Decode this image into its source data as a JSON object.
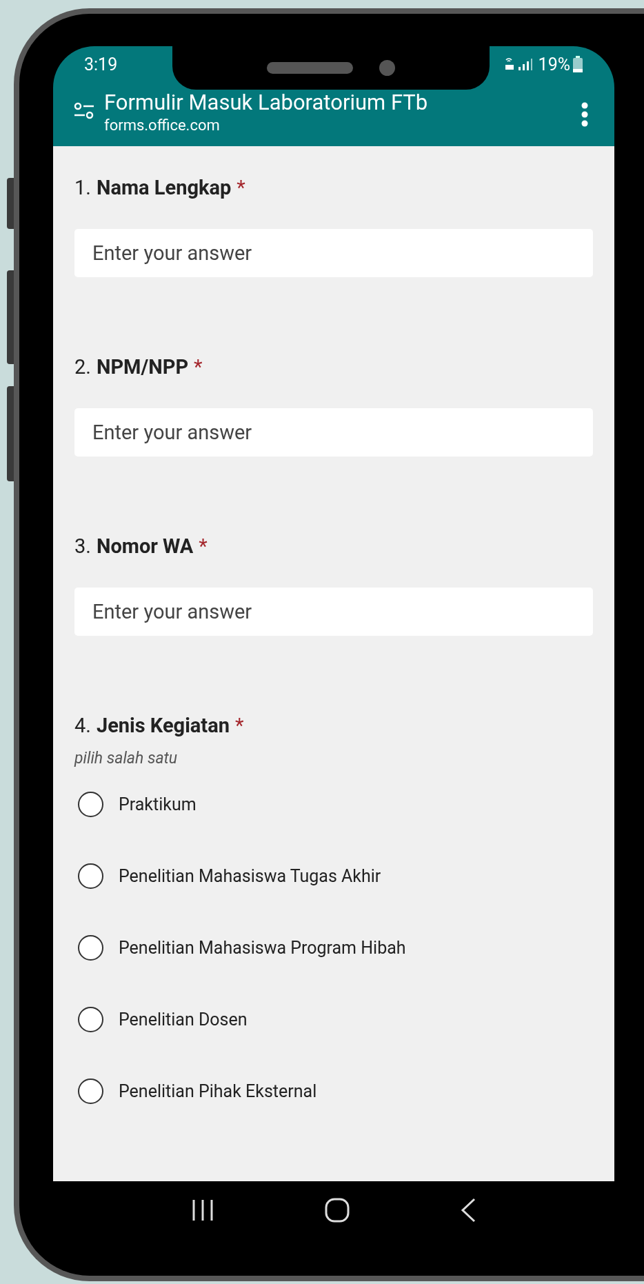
{
  "status_bar": {
    "time": "3:19",
    "battery": "19%"
  },
  "header": {
    "title": "Formulir Masuk Laboratorium FTb",
    "url": "forms.office.com"
  },
  "questions": [
    {
      "kind": "text",
      "number": "1.",
      "title": "Nama Lengkap",
      "required_mark": "*",
      "placeholder": "Enter your answer"
    },
    {
      "kind": "text",
      "number": "2.",
      "title": "NPM/NPP",
      "required_mark": "*",
      "placeholder": "Enter your answer"
    },
    {
      "kind": "text",
      "number": "3.",
      "title": "Nomor WA",
      "required_mark": "*",
      "placeholder": "Enter your answer"
    },
    {
      "kind": "choice",
      "number": "4.",
      "title": "Jenis Kegiatan",
      "required_mark": "*",
      "subtitle": "pilih salah satu",
      "options": [
        {
          "label": "Praktikum",
          "selected": false
        },
        {
          "label": "Penelitian Mahasiswa Tugas Akhir",
          "selected": false
        },
        {
          "label": "Penelitian Mahasiswa Program Hibah",
          "selected": false
        },
        {
          "label": "Penelitian Dosen",
          "selected": false
        },
        {
          "label": "Penelitian Pihak Eksternal",
          "selected": false
        }
      ]
    }
  ]
}
